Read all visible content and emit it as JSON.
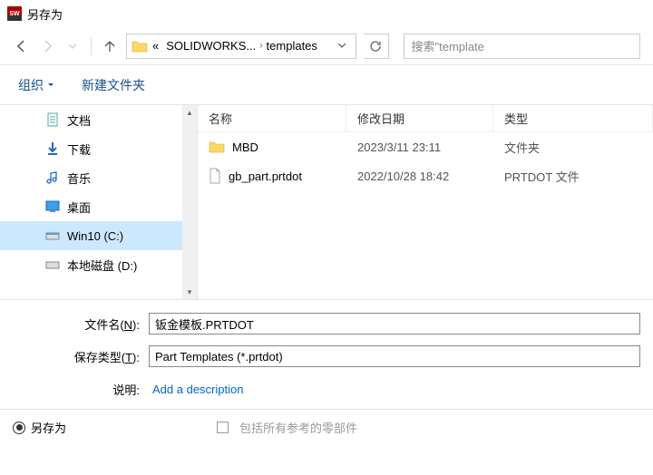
{
  "window": {
    "title": "另存为"
  },
  "nav": {
    "path_prefix": "«",
    "path_parent": "SOLIDWORKS...",
    "path_current": "templates",
    "search_placeholder": "搜索\"template"
  },
  "toolbar": {
    "organize": "组织",
    "new_folder": "新建文件夹"
  },
  "sidebar": {
    "items": [
      {
        "label": "文档",
        "icon": "doc"
      },
      {
        "label": "下载",
        "icon": "download"
      },
      {
        "label": "音乐",
        "icon": "music"
      },
      {
        "label": "桌面",
        "icon": "desktop"
      },
      {
        "label": "Win10 (C:)",
        "icon": "drive",
        "selected": true
      },
      {
        "label": "本地磁盘 (D:)",
        "icon": "drive"
      }
    ]
  },
  "files": {
    "headers": {
      "name": "名称",
      "date": "修改日期",
      "type": "类型"
    },
    "rows": [
      {
        "name": "MBD",
        "date": "2023/3/11 23:11",
        "type": "文件夹",
        "kind": "folder"
      },
      {
        "name": "gb_part.prtdot",
        "date": "2022/10/28 18:42",
        "type": "PRTDOT 文件",
        "kind": "file"
      }
    ]
  },
  "form": {
    "filename_label_pre": "文件名(",
    "filename_label_ul": "N",
    "filename_label_post": "):",
    "filename_value": "钣金模板.PRTDOT",
    "savetype_label_pre": "保存类型(",
    "savetype_label_ul": "T",
    "savetype_label_post": "):",
    "savetype_value": "Part Templates (*.prtdot)",
    "desc_label": "说明:",
    "desc_link": "Add a description"
  },
  "options": {
    "save_as": "另存为",
    "include_refs": "包括所有参考的零部件"
  }
}
